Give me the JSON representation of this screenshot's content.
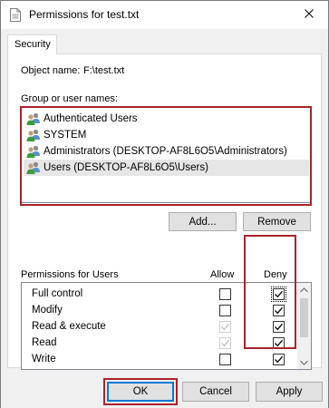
{
  "window": {
    "title": "Permissions for test.txt",
    "close_symbol": "✕"
  },
  "tabs": [
    {
      "label": "Security",
      "selected": true
    }
  ],
  "object": {
    "label": "Object name:",
    "value": "F:\\test.txt"
  },
  "groups": {
    "label": "Group or user names:",
    "items": [
      {
        "label": "Authenticated Users",
        "icon": "users-icon",
        "selected": false
      },
      {
        "label": "SYSTEM",
        "icon": "users-icon",
        "selected": false
      },
      {
        "label": "Administrators (DESKTOP-AF8L6O5\\Administrators)",
        "icon": "users-icon",
        "selected": false
      },
      {
        "label": "Users (DESKTOP-AF8L6O5\\Users)",
        "icon": "users-icon",
        "selected": true
      }
    ]
  },
  "buttons": {
    "add": "Add...",
    "remove": "Remove",
    "ok": "OK",
    "cancel": "Cancel",
    "apply": "Apply"
  },
  "permissions": {
    "label": "Permissions for Users",
    "allow_header": "Allow",
    "deny_header": "Deny",
    "rows": [
      {
        "name": "Full control",
        "allow": false,
        "allow_disabled": false,
        "deny": true
      },
      {
        "name": "Modify",
        "allow": false,
        "allow_disabled": false,
        "deny": true
      },
      {
        "name": "Read & execute",
        "allow": true,
        "allow_disabled": true,
        "deny": true
      },
      {
        "name": "Read",
        "allow": true,
        "allow_disabled": true,
        "deny": true
      },
      {
        "name": "Write",
        "allow": false,
        "allow_disabled": false,
        "deny": true
      }
    ]
  },
  "colors": {
    "highlight": "#a8232c",
    "selection": "#e6e6e6",
    "focus": "#0078d7"
  }
}
